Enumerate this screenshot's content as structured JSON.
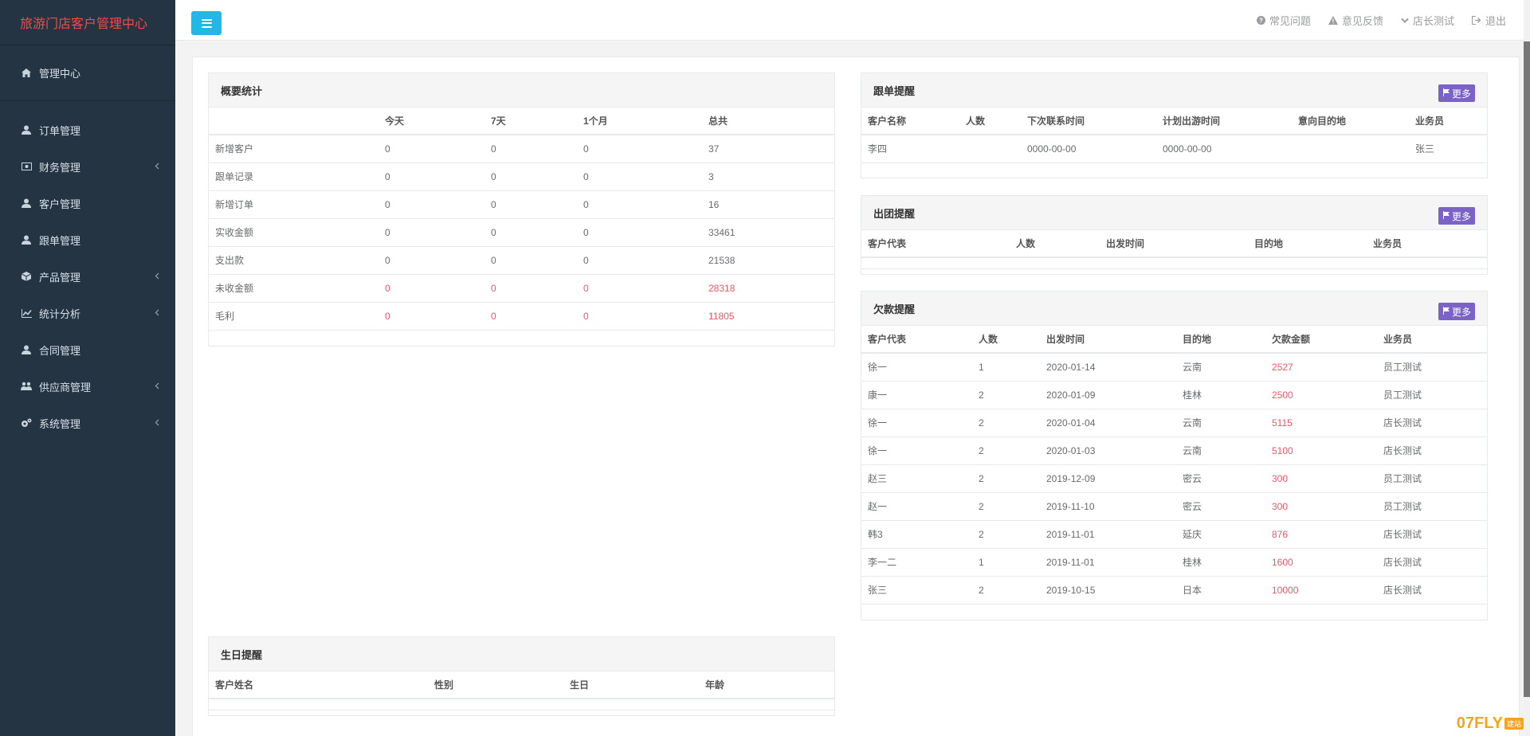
{
  "app": {
    "title": "旅游门店客户管理中心"
  },
  "sidebar": {
    "home": {
      "label": "管理中心",
      "icon": "home-icon"
    },
    "items": [
      {
        "label": "订单管理",
        "icon": "user-icon",
        "arrow": false
      },
      {
        "label": "财务管理",
        "icon": "money-icon",
        "arrow": true
      },
      {
        "label": "客户管理",
        "icon": "user-icon",
        "arrow": false
      },
      {
        "label": "跟单管理",
        "icon": "user-icon",
        "arrow": false
      },
      {
        "label": "产品管理",
        "icon": "cube-icon",
        "arrow": true
      },
      {
        "label": "统计分析",
        "icon": "line-chart-icon",
        "arrow": true
      },
      {
        "label": "合同管理",
        "icon": "user-icon",
        "arrow": false
      },
      {
        "label": "供应商管理",
        "icon": "users-icon",
        "arrow": true
      },
      {
        "label": "系统管理",
        "icon": "gears-icon",
        "arrow": true
      }
    ]
  },
  "topbar": {
    "links": [
      {
        "label": "常见问题",
        "icon": "question-circle-icon"
      },
      {
        "label": "意见反馈",
        "icon": "warning-icon"
      },
      {
        "label": "店长测试",
        "icon": "chevron-down-icon"
      },
      {
        "label": "退出",
        "icon": "sign-out-icon"
      }
    ]
  },
  "overview": {
    "title": "概要统计",
    "columns": [
      "",
      "今天",
      "7天",
      "1个月",
      "总共"
    ],
    "rows": [
      {
        "name": "新增客户",
        "values": [
          "0",
          "0",
          "0",
          "37"
        ],
        "red": false
      },
      {
        "name": "跟单记录",
        "values": [
          "0",
          "0",
          "0",
          "3"
        ],
        "red": false
      },
      {
        "name": "新增订单",
        "values": [
          "0",
          "0",
          "0",
          "16"
        ],
        "red": false
      },
      {
        "name": "实收金额",
        "values": [
          "0",
          "0",
          "0",
          "33461"
        ],
        "red": false
      },
      {
        "name": "支出款",
        "values": [
          "0",
          "0",
          "0",
          "21538"
        ],
        "red": false
      },
      {
        "name": "未收金额",
        "values": [
          "0",
          "0",
          "0",
          "28318"
        ],
        "red": true
      },
      {
        "name": "毛利",
        "values": [
          "0",
          "0",
          "0",
          "11805"
        ],
        "red": true
      }
    ]
  },
  "followup": {
    "title": "跟单提醒",
    "more": "更多",
    "columns": [
      "客户名称",
      "人数",
      "下次联系时间",
      "计划出游时间",
      "意向目的地",
      "业务员"
    ],
    "rows": [
      [
        "李四",
        "",
        "0000-00-00",
        "0000-00-00",
        "",
        "张三"
      ]
    ]
  },
  "departure": {
    "title": "出团提醒",
    "more": "更多",
    "columns": [
      "客户代表",
      "人数",
      "出发时间",
      "目的地",
      "业务员"
    ],
    "rows": []
  },
  "arrears": {
    "title": "欠款提醒",
    "more": "更多",
    "columns": [
      "客户代表",
      "人数",
      "出发时间",
      "目的地",
      "欠款金额",
      "业务员"
    ],
    "rows": [
      [
        "徐一",
        "1",
        "2020-01-14",
        "云南",
        "2527",
        "员工测试"
      ],
      [
        "康一",
        "2",
        "2020-01-09",
        "桂林",
        "2500",
        "员工测试"
      ],
      [
        "徐一",
        "2",
        "2020-01-04",
        "云南",
        "5115",
        "店长测试"
      ],
      [
        "徐一",
        "2",
        "2020-01-03",
        "云南",
        "5100",
        "店长测试"
      ],
      [
        "赵三",
        "2",
        "2019-12-09",
        "密云",
        "300",
        "员工测试"
      ],
      [
        "赵一",
        "2",
        "2019-11-10",
        "密云",
        "300",
        "员工测试"
      ],
      [
        "韩3",
        "2",
        "2019-11-01",
        "延庆",
        "876",
        "店长测试"
      ],
      [
        "李一二",
        "1",
        "2019-11-01",
        "桂林",
        "1600",
        "店长测试"
      ],
      [
        "张三",
        "2",
        "2019-10-15",
        "日本",
        "10000",
        "店长测试"
      ]
    ]
  },
  "birthday": {
    "title": "生日提醒",
    "columns": [
      "客户姓名",
      "性别",
      "生日",
      "年龄"
    ],
    "rows": []
  },
  "watermark": {
    "text": "07FLY",
    "sub": "建站"
  },
  "colors": {
    "sidebar": "#253442",
    "brand": "#f34a4a",
    "accent": "#23b7e5",
    "more": "#7b62c7",
    "danger": "#ed5565"
  }
}
